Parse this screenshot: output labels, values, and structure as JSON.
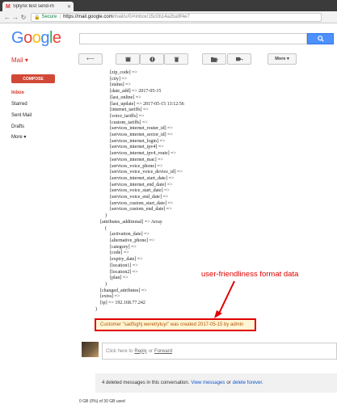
{
  "browser": {
    "tab_title": "Splynx test send-m",
    "secure_label": "Secure",
    "url_host": "https://mail.google.com",
    "url_path": "/mail/u/0/#inbox/15c0b14a2ba9f4e7"
  },
  "header": {
    "logo": [
      "G",
      "o",
      "o",
      "g",
      "l",
      "e"
    ],
    "mail_label": "Mail ▾"
  },
  "toolbar": {
    "more_label": "More ▾"
  },
  "sidebar": {
    "compose_label": "COMPOSE",
    "items": [
      {
        "label": "Inbox"
      },
      {
        "label": "Starred"
      },
      {
        "label": "Sent Mail"
      },
      {
        "label": "Drafts"
      },
      {
        "label": "More ▾"
      }
    ]
  },
  "message": {
    "lines": [
      "            [zip_code] =>",
      "            [city] =>",
      "            [status] =>",
      "            [date_add] => 2017-05-15",
      "            [last_online] =>",
      "            [last_update] => 2017-05-15 13:12:56",
      "            [internet_tariffs] =>",
      "            [voice_tariffs] =>",
      "            [custom_tariffs] =>",
      "            [services_internet_router_id] =>",
      "            [services_internet_sector_id] =>",
      "            [services_internet_login] =>",
      "            [services_internet_ipv4] =>",
      "            [services_internet_ipv4_route] =>",
      "            [services_internet_mac] =>",
      "            [services_voice_phone] =>",
      "            [services_voice_voice_device_id] =>",
      "            [services_internet_start_date] =>",
      "            [services_internet_end_date] =>",
      "            [services_voice_start_date] =>",
      "            [services_voice_end_date] =>",
      "            [services_custom_start_date] =>",
      "            [services_custom_end_date] =>",
      "        )",
      "",
      "    [attributes_additional] => Array",
      "        (",
      "            [activation_date] =>",
      "            [alternative_phone] =>",
      "            [category] =>",
      "            [code] =>",
      "            [expiry_date] =>",
      "            [location1] =>",
      "            [location2] =>",
      "            [plan] =>",
      "        )",
      "",
      "    [changed_attributes] =>",
      "    [extra] =>",
      "    [ip] => 192.168.77.242",
      ")"
    ],
    "annotation": "user-friendliness format data",
    "highlight_text": "Customer \"sadfsghj weretrytuyi\" was created 2017-05-15 by admin"
  },
  "reply": {
    "prefix": "Click here to",
    "reply_link": "Reply",
    "or_text": "or",
    "forward_link": "Forward"
  },
  "deleted_bar": {
    "text": "4 deleted messages in this conversation.",
    "view_link": "View messages",
    "or_text": "or",
    "delete_link": "delete forever."
  },
  "storage": "0 GB (0%) of 30 GB used",
  "colors": {
    "accent_red": "#d14836",
    "link_blue": "#1155cc",
    "annotation_red": "#e00000",
    "secure_green": "#0b8043"
  }
}
